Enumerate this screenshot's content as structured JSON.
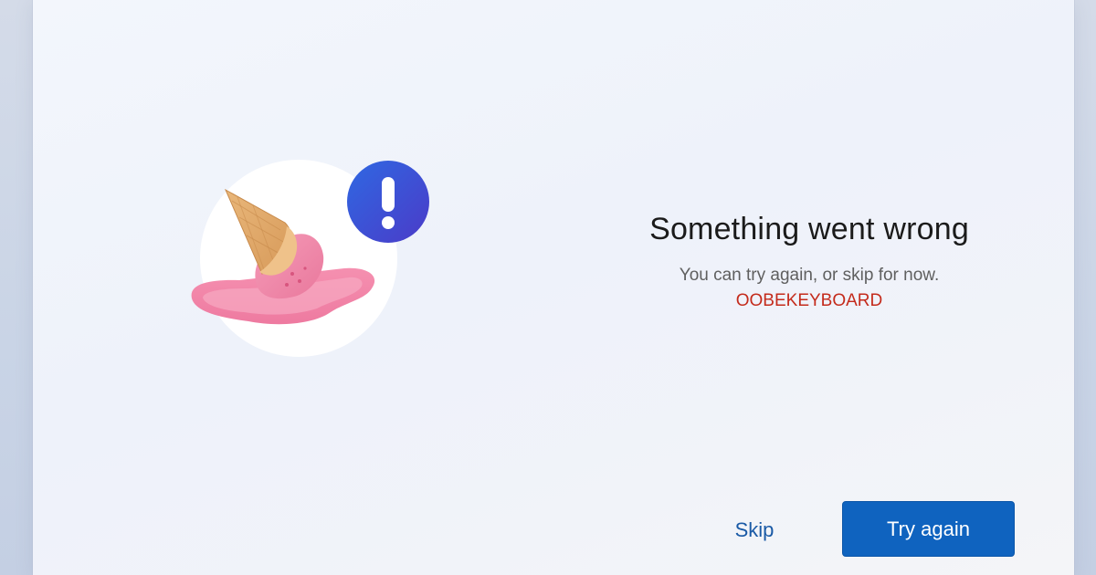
{
  "dialog": {
    "title": "Something went wrong",
    "subtitle": "You can try again, or skip for now.",
    "error_code": "OOBEKEYBOARD"
  },
  "illustration": {
    "icon": "melted-ice-cream-cone-icon",
    "badge_icon": "exclamation-icon",
    "badge_color": "#3b4bd8"
  },
  "buttons": {
    "skip_label": "Skip",
    "try_again_label": "Try again",
    "accent_color": "#0f63bf"
  },
  "colors": {
    "error_code": "#c42b1c",
    "link": "#1a5aa6"
  }
}
